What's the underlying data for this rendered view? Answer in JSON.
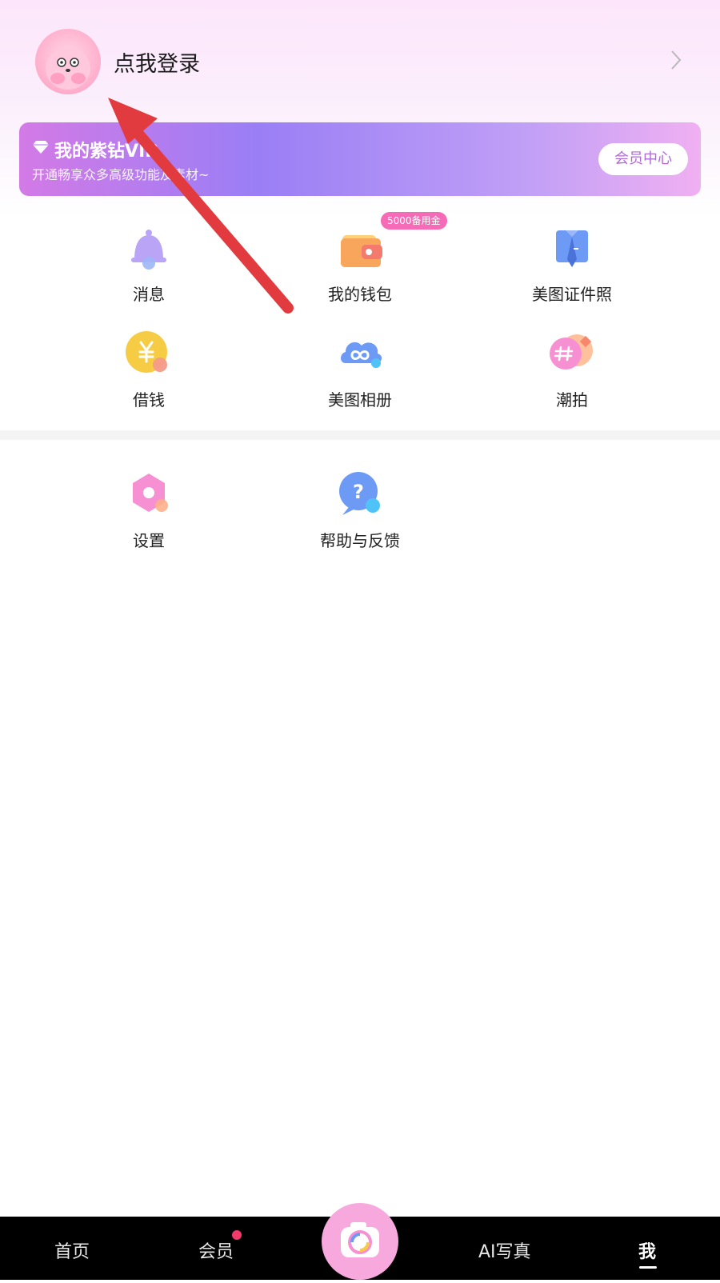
{
  "profile": {
    "login_label": "点我登录"
  },
  "vip": {
    "title": "我的紫钻VIP",
    "subtitle": "开通畅享众多高级功能及素材~",
    "button_label": "会员中心"
  },
  "grid": [
    {
      "label": "消息",
      "icon": "bell-icon",
      "color": "#b9a4f5"
    },
    {
      "label": "我的钱包",
      "icon": "wallet-icon",
      "color": "#f7a65c",
      "badge": "5000备用金"
    },
    {
      "label": "美图证件照",
      "icon": "id-photo-icon",
      "color": "#6d9af5"
    },
    {
      "label": "借钱",
      "icon": "yen-coin-icon",
      "color": "#f7cc45"
    },
    {
      "label": "美图相册",
      "icon": "cloud-album-icon",
      "color": "#6d9af5"
    },
    {
      "label": "潮拍",
      "icon": "hashtag-icon",
      "color": "#f78fd3"
    },
    {
      "label": "设置",
      "icon": "settings-hexagon-icon",
      "color": "#f78fd3"
    },
    {
      "label": "帮助与反馈",
      "icon": "help-question-icon",
      "color": "#6d9af5"
    }
  ],
  "tabbar": {
    "tabs": [
      {
        "label": "首页"
      },
      {
        "label": "会员"
      },
      {
        "label": "AI写真"
      },
      {
        "label": "我"
      }
    ],
    "active": "我",
    "accent": "#f7a8dc"
  }
}
